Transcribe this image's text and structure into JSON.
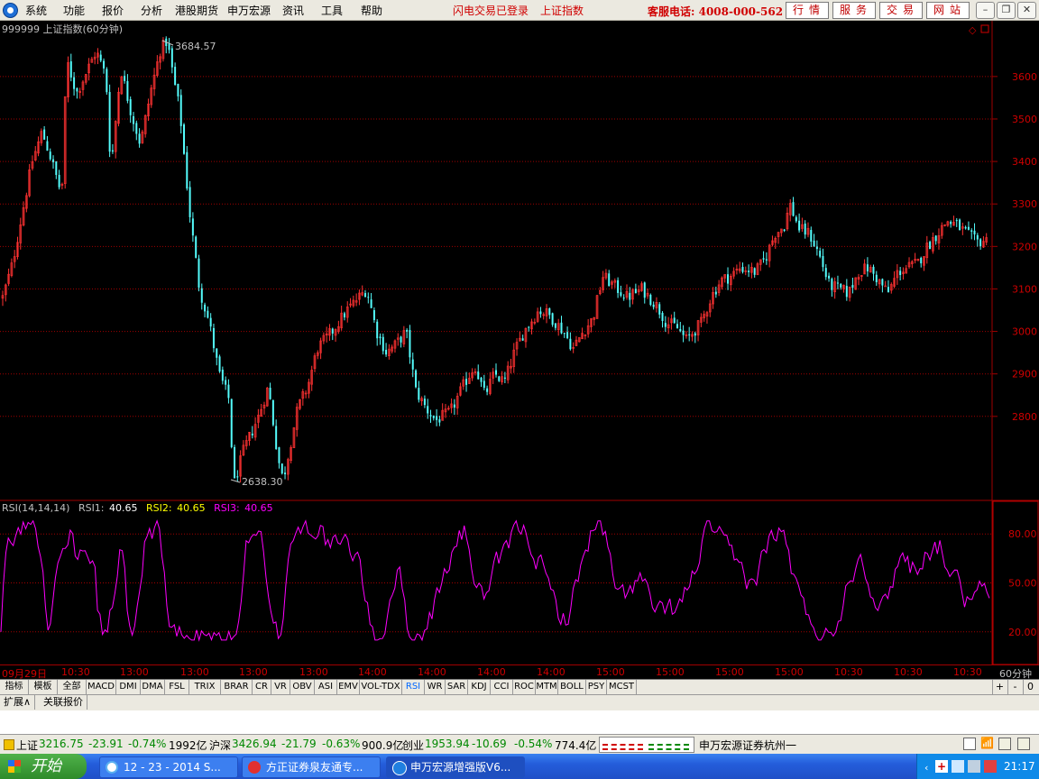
{
  "menu": {
    "items": [
      "系统",
      "功能",
      "报价",
      "分析",
      "港股期货",
      "申万宏源",
      "资讯",
      "工具",
      "帮助"
    ],
    "status_login": "闪电交易已登录",
    "status_index": "上证指数",
    "hotline": "客服电话: 4008-000-562",
    "quick_buttons": [
      "行情",
      "服务",
      "交易",
      "网站"
    ]
  },
  "chart": {
    "title": "999999 上证指数(60分钟)",
    "high_label": "3684.57",
    "low_label": "2638.30",
    "price_ticks": [
      "3600",
      "3500",
      "3400",
      "3300",
      "3200",
      "3100",
      "3000",
      "2900",
      "2800"
    ],
    "rsi_params": "RSI(14,14,14)",
    "rsi1_label": "RSI1:",
    "rsi1_value": "40.65",
    "rsi2_label": "RSI2:",
    "rsi2_value": "40.65",
    "rsi3_label": "RSI3:",
    "rsi3_value": "40.65",
    "rsi_ticks": [
      "80.00",
      "50.00",
      "20.00"
    ],
    "colors": {
      "up": "#ff3232",
      "down": "#54fcfc",
      "rsi": "#ff00ff",
      "grid": "#a00000"
    }
  },
  "chart_data": {
    "type": "candlestick",
    "title": "999999 上证指数(60分钟)",
    "y_range": [
      2600,
      3720
    ],
    "y_ticks": [
      2800,
      2900,
      3000,
      3100,
      3200,
      3300,
      3400,
      3500,
      3600
    ],
    "close_path": [
      [
        0,
        3080
      ],
      [
        0.01,
        3160
      ],
      [
        0.02,
        3280
      ],
      [
        0.03,
        3400
      ],
      [
        0.04,
        3470
      ],
      [
        0.05,
        3400
      ],
      [
        0.06,
        3320
      ],
      [
        0.065,
        3640
      ],
      [
        0.075,
        3560
      ],
      [
        0.085,
        3610
      ],
      [
        0.095,
        3660
      ],
      [
        0.105,
        3600
      ],
      [
        0.11,
        3380
      ],
      [
        0.12,
        3620
      ],
      [
        0.13,
        3520
      ],
      [
        0.14,
        3440
      ],
      [
        0.15,
        3560
      ],
      [
        0.16,
        3660
      ],
      [
        0.167,
        3684.57
      ],
      [
        0.175,
        3580
      ],
      [
        0.18,
        3520
      ],
      [
        0.19,
        3280
      ],
      [
        0.2,
        3100
      ],
      [
        0.21,
        3020
      ],
      [
        0.22,
        2900
      ],
      [
        0.23,
        2840
      ],
      [
        0.235,
        2638.3
      ],
      [
        0.245,
        2720
      ],
      [
        0.26,
        2800
      ],
      [
        0.27,
        2870
      ],
      [
        0.28,
        2700
      ],
      [
        0.285,
        2650
      ],
      [
        0.3,
        2820
      ],
      [
        0.31,
        2870
      ],
      [
        0.32,
        2960
      ],
      [
        0.335,
        3000
      ],
      [
        0.35,
        3050
      ],
      [
        0.37,
        3100
      ],
      [
        0.38,
        3000
      ],
      [
        0.39,
        2950
      ],
      [
        0.4,
        2970
      ],
      [
        0.41,
        3000
      ],
      [
        0.42,
        2860
      ],
      [
        0.43,
        2820
      ],
      [
        0.44,
        2790
      ],
      [
        0.455,
        2810
      ],
      [
        0.47,
        2880
      ],
      [
        0.48,
        2920
      ],
      [
        0.49,
        2850
      ],
      [
        0.5,
        2900
      ],
      [
        0.51,
        2880
      ],
      [
        0.52,
        2950
      ],
      [
        0.53,
        3000
      ],
      [
        0.545,
        3050
      ],
      [
        0.555,
        3040
      ],
      [
        0.57,
        3000
      ],
      [
        0.58,
        2960
      ],
      [
        0.59,
        3000
      ],
      [
        0.6,
        3030
      ],
      [
        0.61,
        3130
      ],
      [
        0.62,
        3110
      ],
      [
        0.635,
        3080
      ],
      [
        0.65,
        3100
      ],
      [
        0.665,
        3060
      ],
      [
        0.675,
        3020
      ],
      [
        0.685,
        3010
      ],
      [
        0.695,
        2980
      ],
      [
        0.71,
        3020
      ],
      [
        0.72,
        3080
      ],
      [
        0.73,
        3120
      ],
      [
        0.74,
        3130
      ],
      [
        0.75,
        3150
      ],
      [
        0.765,
        3140
      ],
      [
        0.775,
        3170
      ],
      [
        0.785,
        3230
      ],
      [
        0.795,
        3250
      ],
      [
        0.8,
        3300
      ],
      [
        0.81,
        3240
      ],
      [
        0.82,
        3230
      ],
      [
        0.83,
        3180
      ],
      [
        0.84,
        3110
      ],
      [
        0.85,
        3100
      ],
      [
        0.86,
        3090
      ],
      [
        0.87,
        3140
      ],
      [
        0.88,
        3150
      ],
      [
        0.89,
        3120
      ],
      [
        0.9,
        3090
      ],
      [
        0.91,
        3140
      ],
      [
        0.92,
        3150
      ],
      [
        0.93,
        3160
      ],
      [
        0.94,
        3200
      ],
      [
        0.95,
        3230
      ],
      [
        0.96,
        3260
      ],
      [
        0.97,
        3250
      ],
      [
        0.98,
        3230
      ],
      [
        0.99,
        3210
      ],
      [
        1.0,
        3215
      ]
    ],
    "rsi_range": [
      0,
      100
    ],
    "rsi_ticks": [
      20,
      50,
      80
    ],
    "rsi_last": 40.65,
    "time_labels": [
      "09月29日",
      "10:30",
      "13:00",
      "13:00",
      "13:00",
      "13:00",
      "14:00",
      "14:00",
      "14:00",
      "14:00",
      "15:00",
      "15:00",
      "15:00",
      "15:00",
      "10:30",
      "10:30",
      "10:30"
    ]
  },
  "timeaxis": {
    "labels": [
      "09月29日",
      "10:30",
      "13:00",
      "13:00",
      "13:00",
      "13:00",
      "14:00",
      "14:00",
      "14:00",
      "14:00",
      "15:00",
      "15:00",
      "15:00",
      "15:00",
      "10:30",
      "10:30",
      "10:30"
    ],
    "unit": "60分钟"
  },
  "tabs": {
    "items": [
      "指标",
      "模板",
      "全部",
      "MACD",
      "DMI",
      "DMA",
      "FSL",
      "TRIX",
      "BRAR",
      "CR",
      "VR",
      "OBV",
      "ASI",
      "EMV",
      "VOL-TDX",
      "RSI",
      "WR",
      "SAR",
      "KDJ",
      "CCI",
      "ROC",
      "MTM",
      "BOLL",
      "PSY",
      "MCST"
    ],
    "active": "RSI",
    "controls": [
      "+",
      "-",
      "0"
    ]
  },
  "ext_tabs": [
    "扩展∧",
    "关联报价"
  ],
  "statusbar": {
    "sh_name": "上证",
    "sh_price": "3216.75",
    "sh_change": "-23.91",
    "sh_pct": "-0.74%",
    "sh_amount": "1992亿",
    "hs_name": "沪深",
    "hs_price": "3426.94",
    "hs_change": "-21.79",
    "hs_pct": "-0.63%",
    "hs_amount": "900.9亿",
    "cy_name": "创业",
    "cy_price": "1953.94",
    "cy_change": "-10.69",
    "cy_pct": "-0.54%",
    "cy_amount": "774.4亿",
    "broker": "申万宏源证券杭州一"
  },
  "taskbar": {
    "start": "开始",
    "tasks": [
      "12 - 23 - 2014 S...",
      "方正证券泉友通专...",
      "申万宏源增强版V6..."
    ],
    "clock": "21:17"
  }
}
